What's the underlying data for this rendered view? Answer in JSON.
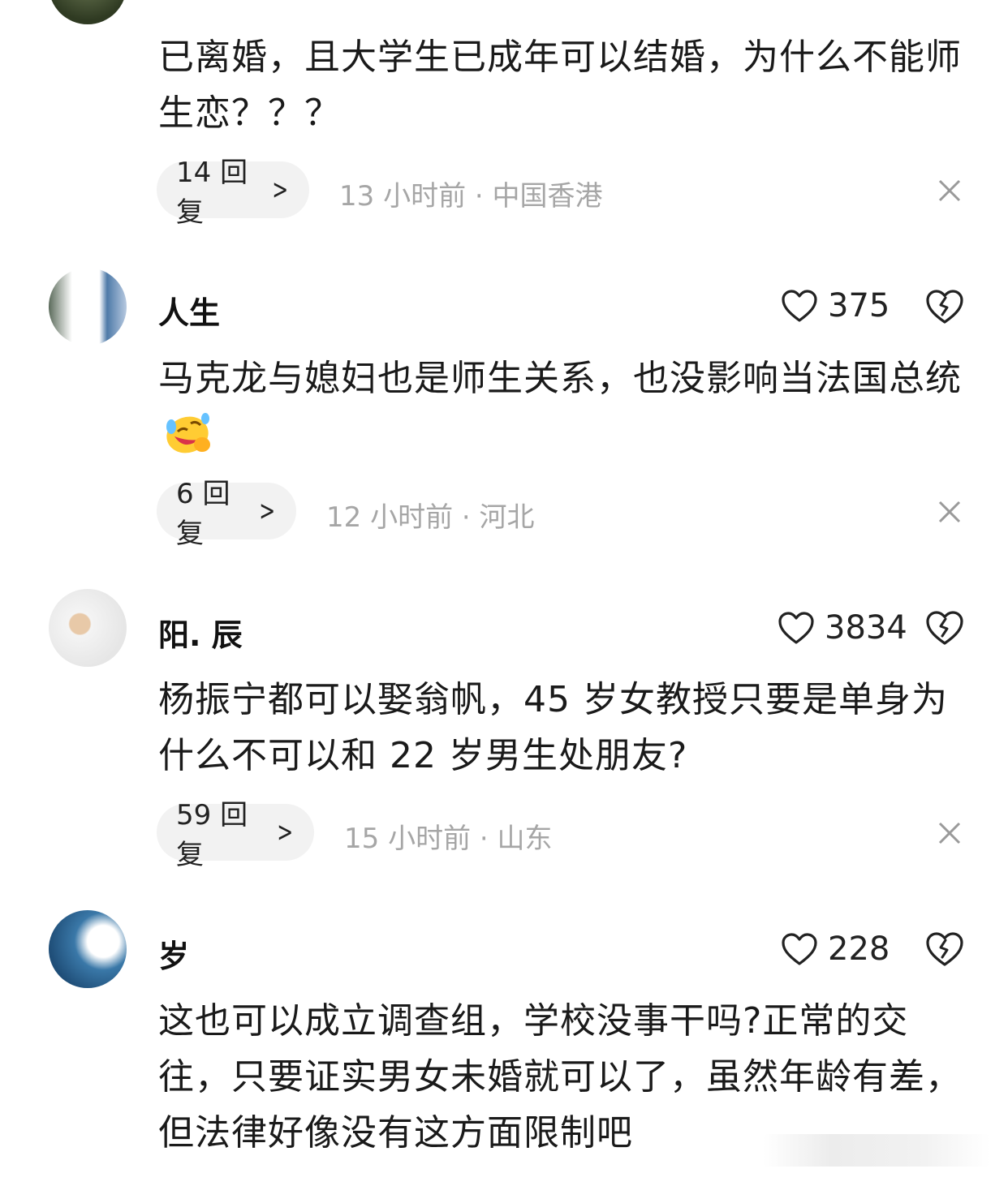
{
  "comments": [
    {
      "username": "",
      "text": "已离婚，且大学生已成年可以结婚，为什么不能师生恋？？？",
      "reply_label": "14 回复",
      "meta": "13 小时前 · 中国香港"
    },
    {
      "username": "人生",
      "likes": "375",
      "text": "马克龙与媳妇也是师生关系，也没影响当法国总统",
      "emoji": "rofl-emoji",
      "reply_label": "6 回复",
      "meta": "12 小时前 · 河北"
    },
    {
      "username": "阳. 辰",
      "likes": "3834",
      "text": "杨振宁都可以娶翁帆，45 岁女教授只要是单身为什么不可以和 22 岁男生处朋友?",
      "reply_label": "59 回复",
      "meta": "15 小时前 · 山东"
    },
    {
      "username": "岁",
      "likes": "228",
      "text": "这也可以成立调查组，学校没事干吗?正常的交往，只要证实男女未婚就可以了，虽然年龄有差，但法律好像没有这方面限制吧"
    }
  ],
  "icons": {
    "like": "heart-outline-icon",
    "dislike": "broken-heart-icon",
    "close": "close-icon",
    "chevron": "chevron-right-icon"
  },
  "colors": {
    "meta": "#a6a6a6",
    "reply_bg": "#f2f2f2",
    "text": "#1a1a1a"
  }
}
